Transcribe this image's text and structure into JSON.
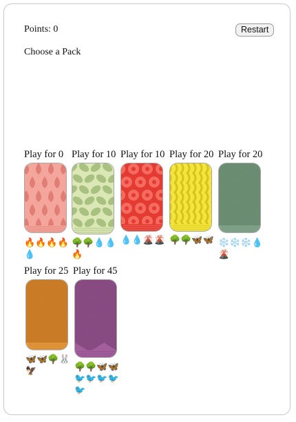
{
  "header": {
    "points_text": "Points: 0",
    "restart_label": "Restart"
  },
  "main": {
    "prompt": "Choose a Pack"
  },
  "packs": [
    {
      "price_label": "Play for 0",
      "pattern": "drops",
      "base_color": "#f4a59c",
      "accent_color": "#e07d74",
      "contents": [
        "🔥",
        "🔥",
        "🔥",
        "🔥",
        "💧"
      ]
    },
    {
      "price_label": "Play for 10",
      "pattern": "leaves",
      "base_color": "#dbe7b5",
      "accent_color": "#a8c080",
      "contents": [
        "🌳",
        "🌳",
        "💧",
        "💧",
        "🔥"
      ]
    },
    {
      "price_label": "Play for 10",
      "pattern": "circles",
      "base_color": "#e33b32",
      "accent_color": "#f56b60",
      "contents": [
        "💧",
        "💧",
        "🌋",
        "🌋"
      ]
    },
    {
      "price_label": "Play for 20",
      "pattern": "waves",
      "base_color": "#f3e53b",
      "accent_color": "#d8c51c",
      "contents": [
        "🌳",
        "🌳",
        "🦋",
        "🦋"
      ]
    },
    {
      "price_label": "Play for 20",
      "pattern": "diamonds",
      "base_color": "#86a68d",
      "accent_color": "#6a8d72",
      "contents": [
        "❄️",
        "❄️",
        "❄️",
        "💧",
        "🌋"
      ]
    },
    {
      "price_label": "Play for 25",
      "pattern": "diamonds",
      "base_color": "#e69b3e",
      "accent_color": "#c97b25",
      "contents": [
        "🦋",
        "🦋",
        "🌳",
        "🐰",
        "🦅"
      ]
    },
    {
      "price_label": "Play for 45",
      "pattern": "diamonds",
      "base_color": "#a35f9c",
      "accent_color": "#874b82",
      "contents": [
        "🌳",
        "🌳",
        "🦋",
        "🦋",
        "🐦",
        "🐦",
        "🐦",
        "🐦",
        "🐦"
      ]
    }
  ]
}
